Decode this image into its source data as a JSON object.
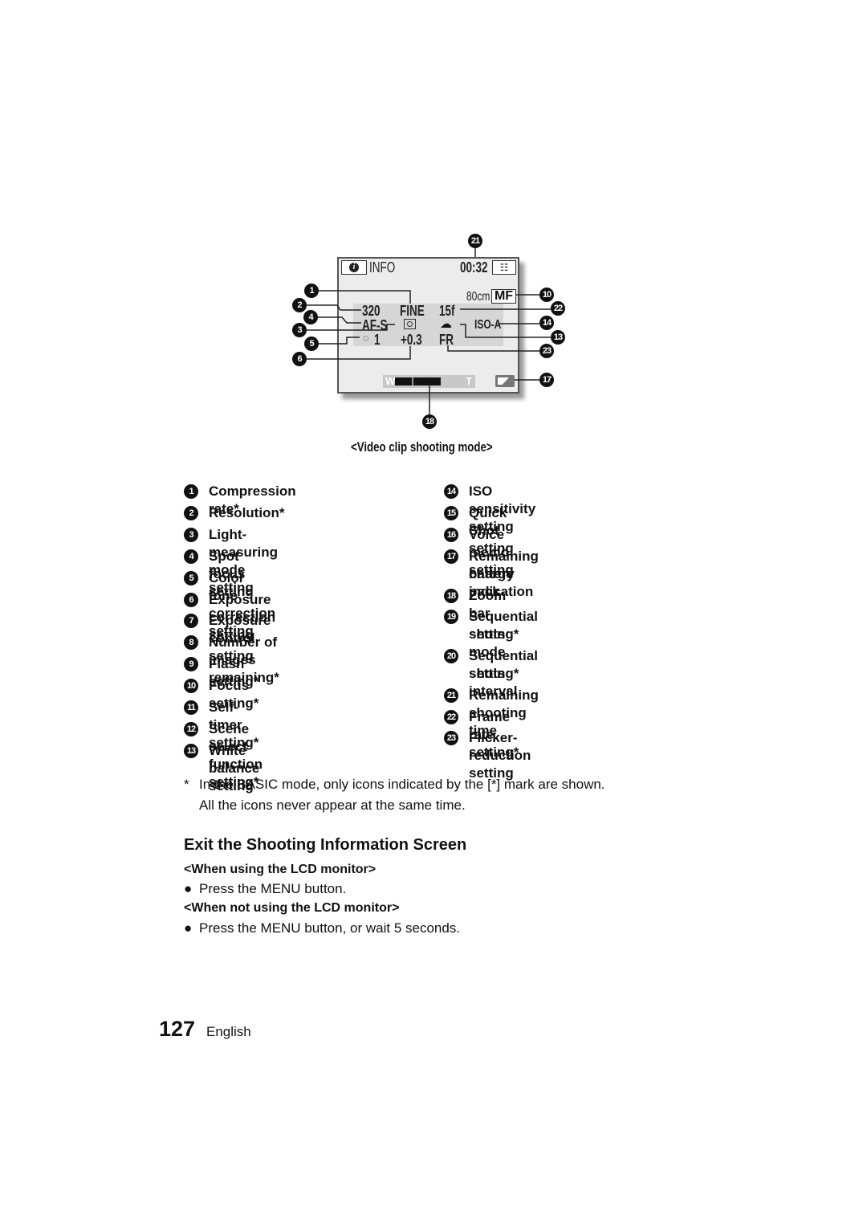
{
  "diagram": {
    "info_label": "INFO",
    "info_icon": "info-icon",
    "remaining_time": "00:32",
    "film_icon": "video-clip-icon",
    "focus_distance": "80cm",
    "focus_mode": "MF",
    "resolution": "320",
    "compression": "FINE",
    "frame_rate": "15f",
    "spot_focus": "AF-S",
    "metering_icon": "spot-metering-icon",
    "white_balance_icon": "cloudy-icon",
    "iso": "ISO-A",
    "color_tone": "1",
    "color_tone_icon": "palette-icon",
    "exposure": "+0.3",
    "flicker": "FR",
    "zoom_w": "W",
    "zoom_t": "T",
    "battery_icon": "battery-icon",
    "callouts": [
      "1",
      "2",
      "3",
      "4",
      "5",
      "6",
      "10",
      "13",
      "14",
      "17",
      "18",
      "21",
      "22",
      "23"
    ],
    "caption": "<Video clip shooting mode>"
  },
  "legend": {
    "left": [
      {
        "n": "1",
        "label": "Compression rate*"
      },
      {
        "n": "2",
        "label": "Resolution*"
      },
      {
        "n": "3",
        "label": "Light-measuring mode setting"
      },
      {
        "n": "4",
        "label": "Spot focus setting"
      },
      {
        "n": "5",
        "label": "Color tone correction setting"
      },
      {
        "n": "6",
        "label": "Exposure correction setting"
      },
      {
        "n": "7",
        "label": "Exposure control setting"
      },
      {
        "n": "8",
        "label": "Number of images remaining*"
      },
      {
        "n": "9",
        "label": "Flash setting*"
      },
      {
        "n": "10",
        "label": "Focus setting*"
      },
      {
        "n": "11",
        "label": "Self-timer setting*"
      },
      {
        "n": "12",
        "label": "Scene select function setting*"
      },
      {
        "n": "13",
        "label": "White balance setting"
      }
    ],
    "right": [
      {
        "n": "14",
        "label": "ISO sensitivity setting",
        "label2": ""
      },
      {
        "n": "15",
        "label": "Quick Shot setting",
        "label2": ""
      },
      {
        "n": "16",
        "label": "Voice memo setting",
        "label2": ""
      },
      {
        "n": "17",
        "label": "Remaining battery pack",
        "label2": "charge indication"
      },
      {
        "n": "18",
        "label": "Zoom bar",
        "label2": ""
      },
      {
        "n": "19",
        "label": "Sequential shots mode",
        "label2": "setting*"
      },
      {
        "n": "20",
        "label": "Sequential shots interval",
        "label2": "setting*"
      },
      {
        "n": "21",
        "label": "Remaining shooting time",
        "label2": ""
      },
      {
        "n": "22",
        "label": "Frame rate setting*",
        "label2": ""
      },
      {
        "n": "23",
        "label": "Flicker-reduction setting",
        "label2": ""
      }
    ]
  },
  "note": {
    "mark": "*",
    "line1": "In the BASIC mode, only icons indicated by the [*] mark are shown.",
    "line2": "All the icons never appear at the same time."
  },
  "section": {
    "title": "Exit the Shooting Information Screen",
    "sub1": "<When using the LCD monitor>",
    "bullet1": "Press the MENU button.",
    "sub2": "<When not using the LCD monitor>",
    "bullet2": "Press the MENU button, or wait 5 seconds."
  },
  "footer": {
    "page_number": "127",
    "language": "English"
  }
}
